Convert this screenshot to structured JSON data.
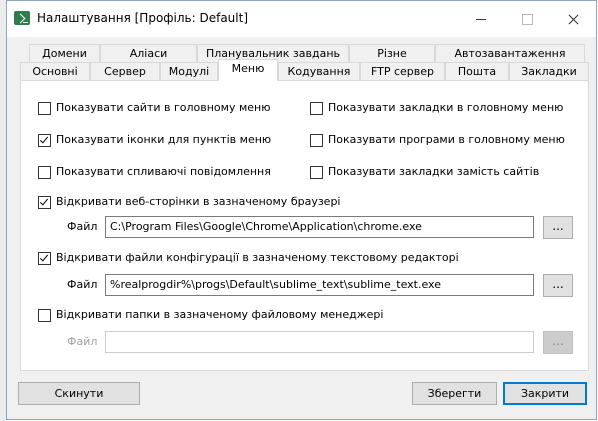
{
  "window": {
    "title": "Налаштування [Профіль: Default]"
  },
  "tabs": {
    "row_back": [
      "Домени",
      "Аліаси",
      "Планувальник завдань",
      "Різне",
      "Автозавантаження"
    ],
    "row_front": [
      "Основні",
      "Сервер",
      "Модулі",
      "Меню",
      "Кодування",
      "FTP сервер",
      "Пошта",
      "Закладки"
    ],
    "active": "Меню"
  },
  "menu": {
    "options_left": [
      {
        "label": "Показувати сайти в головному меню",
        "checked": false
      },
      {
        "label": "Показувати іконки для пунктів меню",
        "checked": true
      },
      {
        "label": "Показувати спливаючі повідомлення",
        "checked": false
      }
    ],
    "options_right": [
      {
        "label": "Показувати закладки в головному меню",
        "checked": false
      },
      {
        "label": "Показувати програми в головному меню",
        "checked": false
      },
      {
        "label": "Показувати закладки замість сайтів",
        "checked": false
      }
    ],
    "browser": {
      "label": "Відкривати веб-сторінки в зазначеному браузері",
      "checked": true,
      "file_label": "Файл",
      "path": "C:\\Program Files\\Google\\Chrome\\Application\\chrome.exe",
      "browse": "..."
    },
    "editor": {
      "label": "Відкривати файли конфігурації в зазначеному текстовому редакторі",
      "checked": true,
      "file_label": "Файл",
      "path": "%realprogdir%\\progs\\Default\\sublime_text\\sublime_text.exe",
      "browse": "..."
    },
    "filemanager": {
      "label": "Відкривати папки в зазначеному файловому менеджері",
      "checked": false,
      "file_label": "Файл",
      "path": "",
      "browse": "..."
    }
  },
  "buttons": {
    "reset": "Скинути",
    "save": "Зберегти",
    "close": "Закрити"
  },
  "colors": {
    "accent": "#0078d7",
    "window_bg": "#f0f0f0",
    "panel_bg": "#ffffff",
    "disabled_text": "#a0a0a0"
  }
}
